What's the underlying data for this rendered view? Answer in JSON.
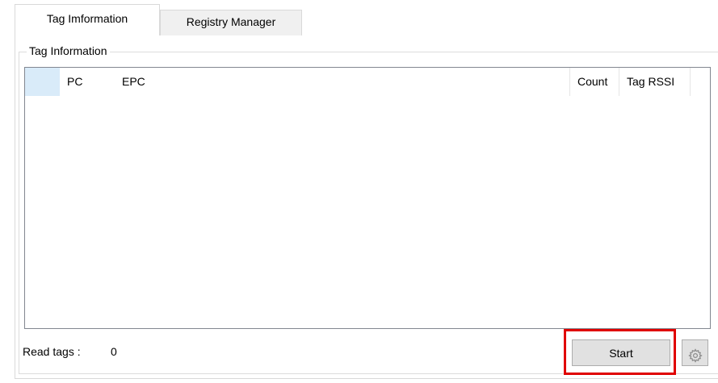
{
  "tabs": [
    {
      "label": "Tag Imformation",
      "active": true
    },
    {
      "label": "Registry Manager",
      "active": false
    }
  ],
  "group": {
    "title": "Tag Information"
  },
  "table": {
    "columns": [
      "",
      "PC",
      "EPC",
      "Count",
      "Tag RSSI"
    ],
    "rows": []
  },
  "status": {
    "read_tags_label": "Read tags :",
    "read_tags_value": "0"
  },
  "buttons": {
    "start_label": "Start",
    "settings_icon": "gear-icon"
  },
  "colors": {
    "highlight": "#e00000",
    "selected_header": "#d9ebf9",
    "button_face": "#e1e1e1"
  }
}
